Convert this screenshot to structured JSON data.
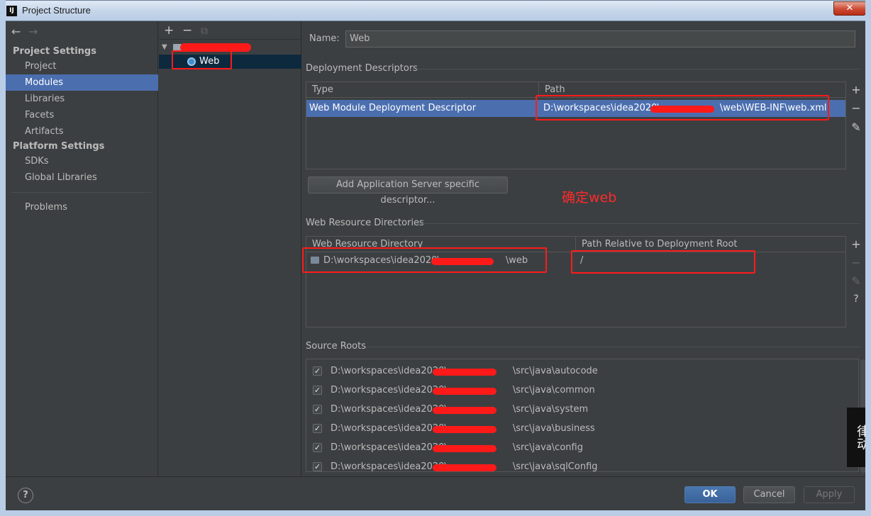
{
  "window": {
    "title": "Project Structure",
    "app_icon": "IJ",
    "close_glyph": "✕"
  },
  "nav": {
    "back": "←",
    "forward": "→",
    "project_settings_header": "Project Settings",
    "project_settings": [
      "Project",
      "Modules",
      "Libraries",
      "Facets",
      "Artifacts"
    ],
    "platform_settings_header": "Platform Settings",
    "platform_settings": [
      "SDKs",
      "Global Libraries"
    ],
    "problems": "Problems",
    "selected": "Modules"
  },
  "tree": {
    "add": "+",
    "remove": "−",
    "copy": "⧉",
    "root_expand": "▼",
    "child_label": "Web"
  },
  "module": {
    "name_label": "Name:",
    "name_value": "Web",
    "deployment_descriptors_title": "Deployment Descriptors",
    "dd_columns": [
      "Type",
      "Path"
    ],
    "dd_rows": [
      {
        "type": "Web Module Deployment Descriptor",
        "path_prefix": "D:\\workspaces\\idea2020\\",
        "path_suffix": "\\web\\WEB-INF\\web.xml"
      }
    ],
    "add_descriptor_button": "Add Application Server specific descriptor...",
    "web_resource_title": "Web Resource Directories",
    "wr_columns": [
      "Web Resource Directory",
      "Path Relative to Deployment Root"
    ],
    "wr_rows": [
      {
        "dir_prefix": "D:\\workspaces\\idea2020\\",
        "dir_suffix": "\\web",
        "relative": "/"
      }
    ],
    "source_roots_title": "Source Roots",
    "source_roots": [
      {
        "prefix": "D:\\workspaces\\idea2020\\",
        "suffix": "\\src\\java\\autocode",
        "checked": true
      },
      {
        "prefix": "D:\\workspaces\\idea2020\\",
        "suffix": "\\src\\java\\common",
        "checked": true
      },
      {
        "prefix": "D:\\workspaces\\idea2020\\",
        "suffix": "\\src\\java\\system",
        "checked": true
      },
      {
        "prefix": "D:\\workspaces\\idea2020\\",
        "suffix": "\\src\\java\\business",
        "checked": true
      },
      {
        "prefix": "D:\\workspaces\\idea2020\\",
        "suffix": "\\src\\java\\config",
        "checked": true
      },
      {
        "prefix": "D:\\workspaces\\idea2020\\",
        "suffix": "\\src\\java\\sqlConfig",
        "checked": true
      }
    ],
    "side_add": "+",
    "side_remove": "−",
    "side_edit": "✎",
    "side_help": "?"
  },
  "annotation": {
    "text": "确定web",
    "color": "#ff2a2a"
  },
  "footer": {
    "help": "?",
    "ok": "OK",
    "cancel": "Cancel",
    "apply": "Apply"
  },
  "watermark": "律动",
  "colors": {
    "selection": "#4b6eaf",
    "background": "#3c3f41",
    "redline": "#ff1a1a"
  }
}
